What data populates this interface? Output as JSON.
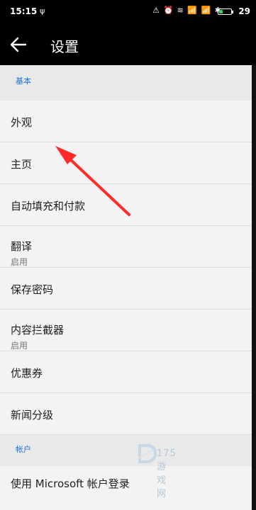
{
  "statusbar": {
    "time": "15:15",
    "time_icon": "ψ",
    "status_icons": "⚠ ⏰ ≋ 📶 📶 ✱",
    "battery_level": 0.29,
    "battery_text": "29",
    "battery_color": "#3bd16f"
  },
  "topbar": {
    "back_icon": "arrow-left-icon",
    "title": "设置"
  },
  "sections": {
    "basic_header": "基本",
    "items": [
      {
        "label": "外观"
      },
      {
        "label": "主页"
      },
      {
        "label": "自动填充和付款"
      },
      {
        "label": "翻译",
        "sub": "启用"
      },
      {
        "label": "保存密码"
      },
      {
        "label": "内容拦截器",
        "sub": "启用"
      },
      {
        "label": "优惠券"
      },
      {
        "label": "新闻分级"
      }
    ],
    "account_header": "帐户",
    "account_item": "使用 Microsoft 帐户登录"
  },
  "annotation": {
    "arrow_color": "#ff2a2a"
  },
  "watermark": {
    "text": "175游戏网"
  },
  "colors": {
    "accent": "#1c6fd6",
    "header_bg": "#000000",
    "list_bg": "#f3f3f3"
  }
}
